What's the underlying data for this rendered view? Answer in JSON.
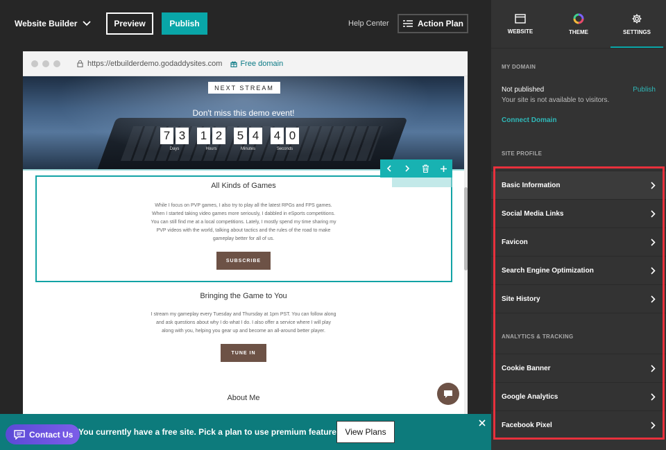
{
  "topbar": {
    "app_title": "Website Builder",
    "preview_label": "Preview",
    "publish_label": "Publish",
    "help_center": "Help Center",
    "action_plan_label": "Action Plan"
  },
  "browser": {
    "url": "https://etbuilderdemo.godaddysites.com",
    "free_domain": "Free domain"
  },
  "hero": {
    "badge": "NEXT STREAM",
    "heading": "Don't miss this demo event!",
    "countdown": [
      {
        "digits": [
          "7",
          "3"
        ],
        "label": "Days"
      },
      {
        "digits": [
          "1",
          "2"
        ],
        "label": "Hours"
      },
      {
        "digits": [
          "5",
          "4"
        ],
        "label": "Minutes"
      },
      {
        "digits": [
          "4",
          "0"
        ],
        "label": "Seconds"
      }
    ]
  },
  "sections": [
    {
      "title": "All Kinds of Games",
      "body": "While I focus on PVP games, I also try to play all the latest RPGs and FPS games. When I started taking video games more seriously, I dabbled in eSports competitions. You can still find me at a local competitions. Lately, I mostly spend my time sharing my PVP videos with the world, talking about tactics and the rules of the road to make gameplay better for all of us.",
      "button": "SUBSCRIBE"
    },
    {
      "title": "Bringing the Game to You",
      "body": "I stream my gameplay every Tuesday and Thursday at 1pm PST. You can follow along and ask questions about why I do what I do. I also offer a service where I will play along with you, helping you gear up and become an all-around better player.",
      "button": "TUNE IN"
    },
    {
      "title": "About Me"
    }
  ],
  "banner": {
    "text": "You currently have a free site. Pick a plan to use premium features.",
    "view_plans": "View Plans",
    "contact_us": "Contact Us"
  },
  "panel": {
    "tabs": [
      {
        "label": "WEBSITE",
        "icon": "website-icon"
      },
      {
        "label": "THEME",
        "icon": "theme-icon"
      },
      {
        "label": "SETTINGS",
        "icon": "gear-icon"
      }
    ],
    "my_domain": {
      "label": "MY DOMAIN",
      "status": "Not published",
      "publish_link": "Publish",
      "description": "Your site is not available to visitors.",
      "connect_link": "Connect Domain"
    },
    "site_profile": {
      "label": "SITE PROFILE",
      "items": [
        "Basic Information",
        "Social Media Links",
        "Favicon",
        "Search Engine Optimization",
        "Site History"
      ]
    },
    "analytics": {
      "label": "ANALYTICS & TRACKING",
      "items": [
        "Cookie Banner",
        "Google Analytics",
        "Facebook Pixel"
      ]
    }
  },
  "colors": {
    "accent": "#09a6a8",
    "banner": "#0d7b7c",
    "button_brown": "#6d5246",
    "highlight": "#e8303c"
  }
}
